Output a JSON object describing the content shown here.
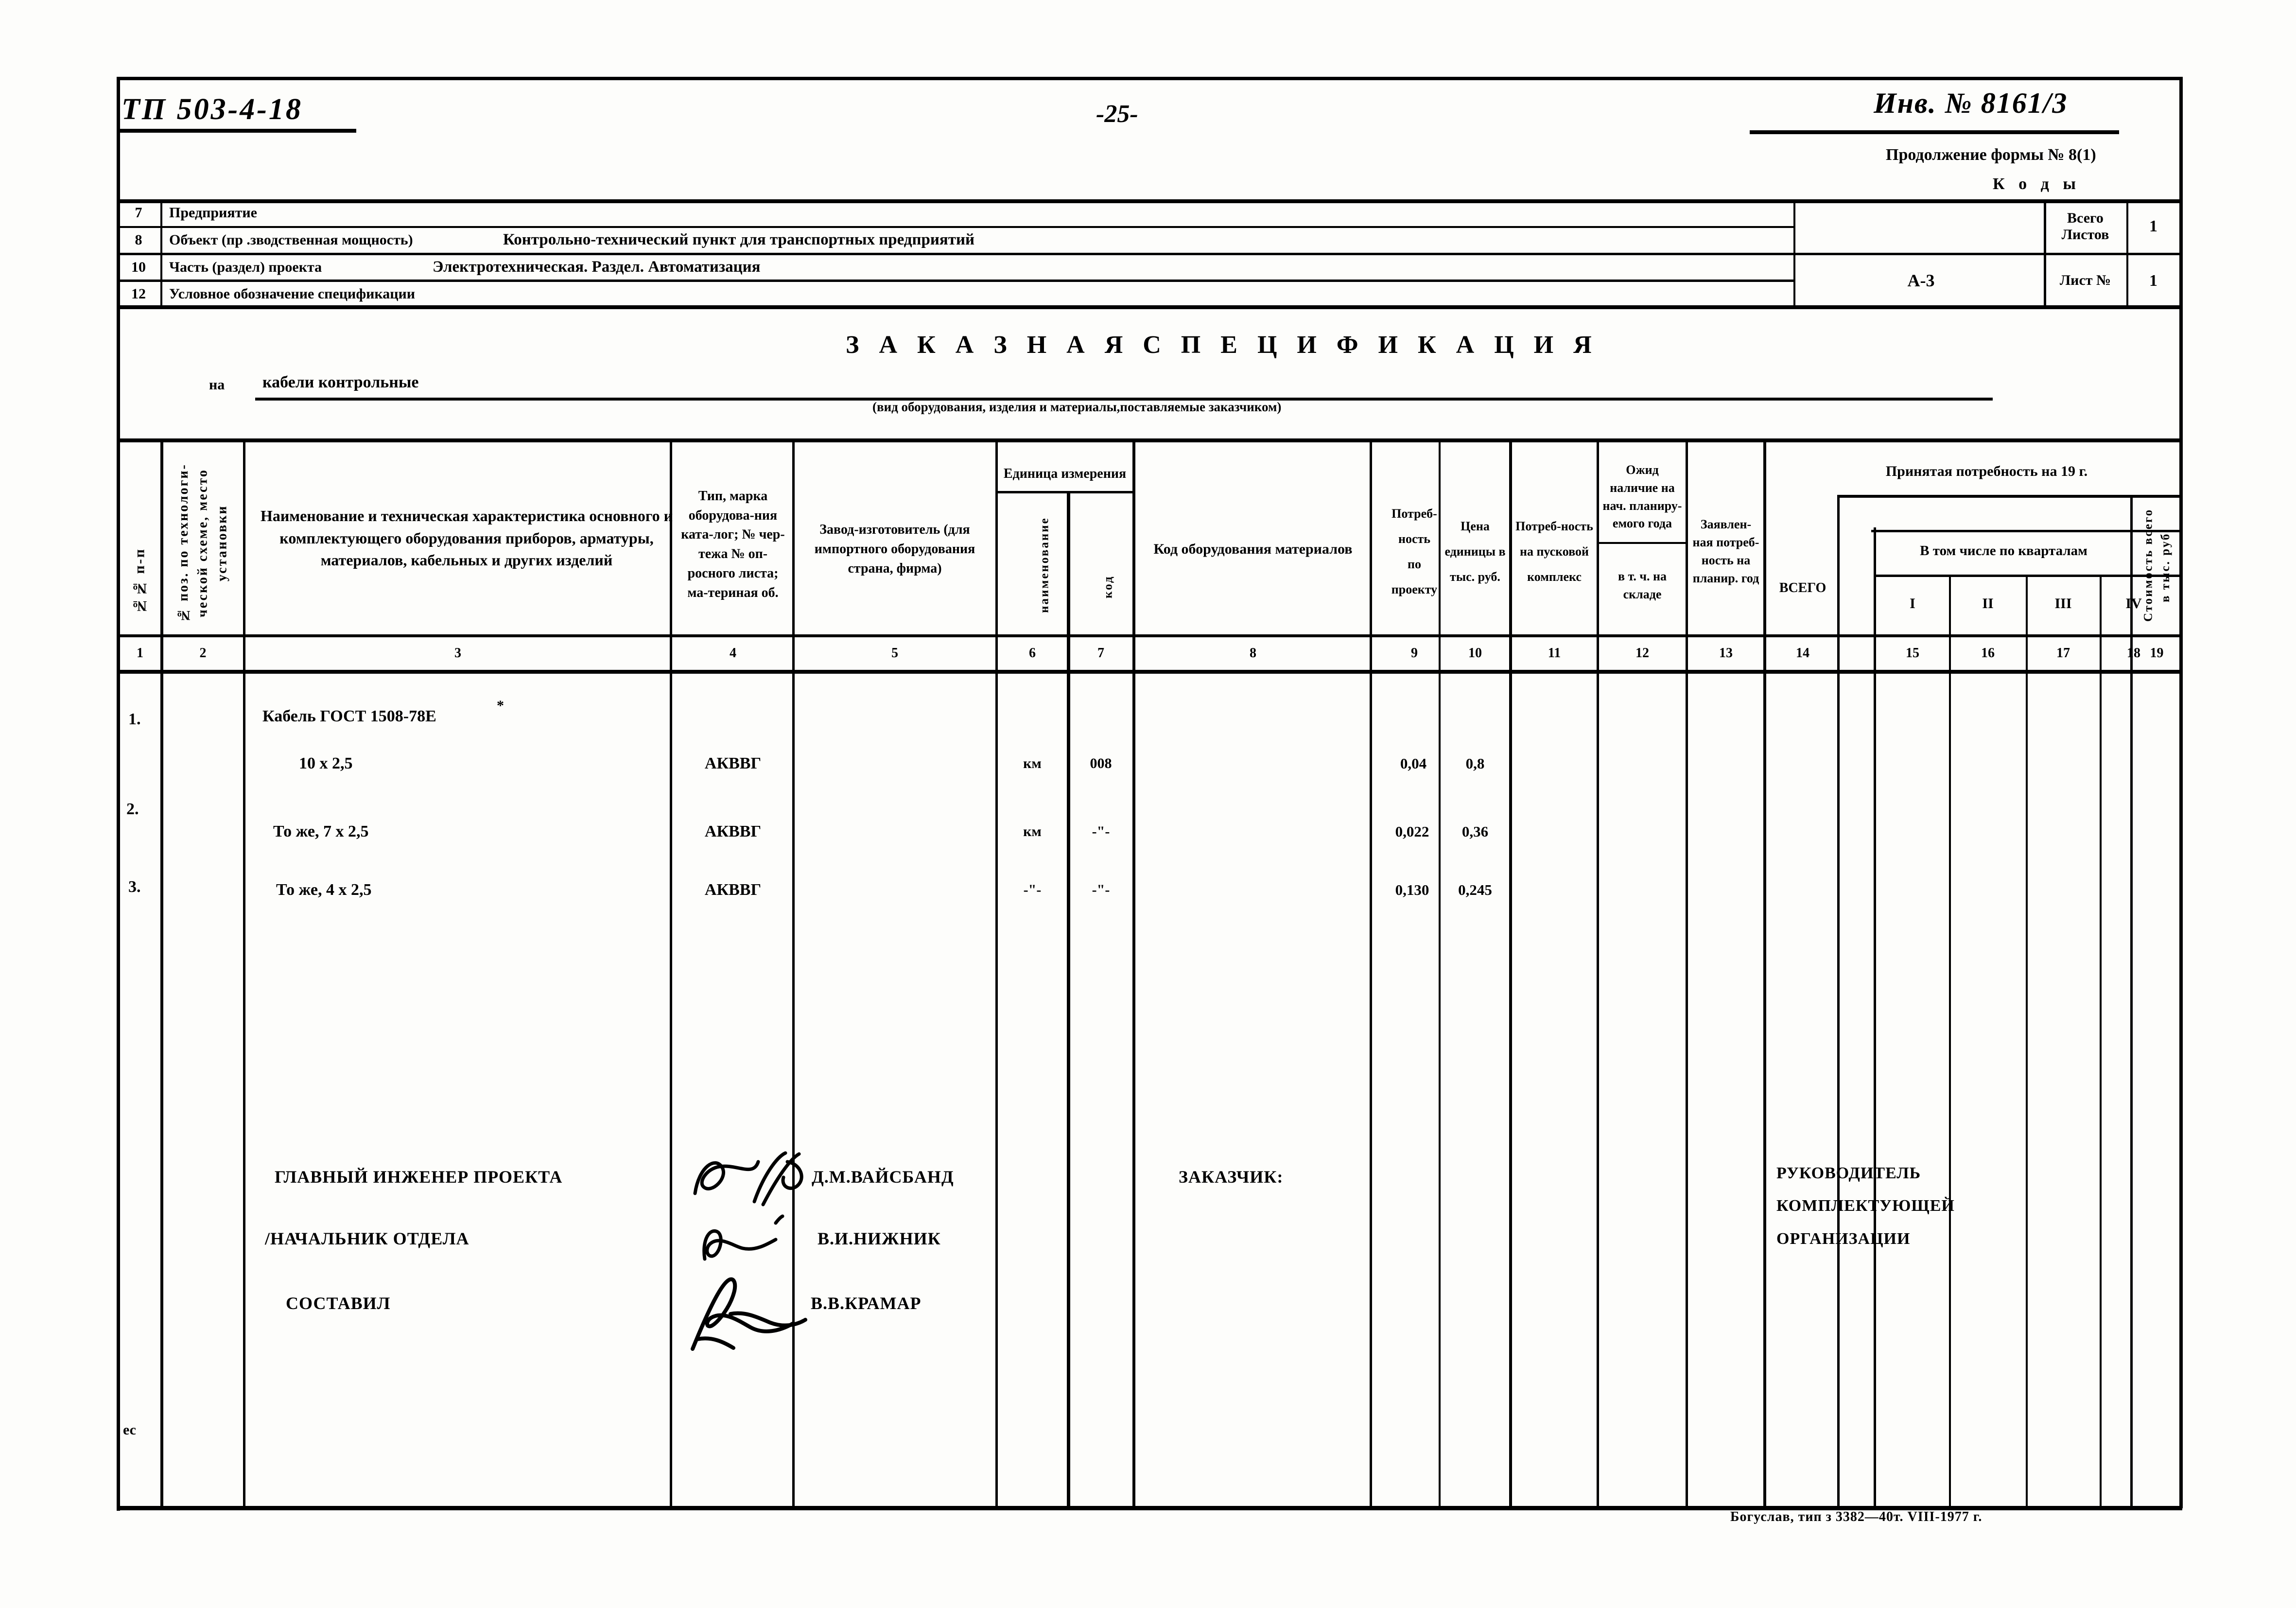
{
  "top": {
    "tp_code": "ТП 503-4-18",
    "page_number": "-25-",
    "inventory_number": "Инв. № 8161/3",
    "form_continuation": "Продолжение формы № 8(1)",
    "kody_label": "К о д ы"
  },
  "header_rows": [
    {
      "num": "7",
      "label": "Предприятие",
      "value": ""
    },
    {
      "num": "8",
      "label": "Объект (пр .зводственная мощность)",
      "value": "Контрольно-технический пункт для транспортных предприятий"
    },
    {
      "num": "10",
      "label": "Часть (раздел) проекта",
      "value": "Электротехническая. Раздел. Автоматизация"
    },
    {
      "num": "12",
      "label": "Условное обозначение спецификации",
      "value": ""
    }
  ],
  "header_right": {
    "spec_code": "А-3",
    "total_sheets_label": "Всего\nЛистов",
    "total_sheets_value": "1",
    "sheet_no_label": "Лист №",
    "sheet_no_value": "1"
  },
  "title": {
    "main": "З А К А З Н А Я   С П Е Ц И Ф И К А Ц И Я",
    "na_label": "на",
    "na_value": "кабели контрольные",
    "subtitle": "(вид оборудования, изделия и материалы,поставляемые заказчиком)"
  },
  "table": {
    "headers": {
      "col1": "№№ п-п",
      "col2": "№ поз. по технологи-ческой схеме, место установки",
      "col3": "Наименование и техническая характеристика основного и комплектующего оборудования приборов, арматуры, материалов, кабельных и других изделий",
      "col4": "Тип, марка оборудова-ния ката-лог; № чер-тежа № оп-росного листа; ма-териная об.",
      "col5": "Завод-изготовитель (для импортного оборудования страна, фирма)",
      "col67_group": "Единица измерения",
      "col6": "наименование",
      "col7": "код",
      "col8": "Код оборудования материалов",
      "col9": "Потреб-ность по проекту",
      "col10": "Цена единицы в тыс. руб.",
      "col11": "Потреб-ность на пусковой комплекс",
      "col12_top": "Ожид наличие на нач. планиру-емого года",
      "col12_bottom": "в т. ч. на складе",
      "col13": "Заявлен-ная потреб-ность на планир. год",
      "col14_19_group": "Принятая потребность на 19        г.",
      "col14": "ВСЕГО",
      "col15_18_group": "В том числе по кварталам",
      "col15": "I",
      "col16": "II",
      "col17": "III",
      "col18": "IV",
      "col19": "Стоимость  всего в тыс. руб."
    },
    "column_numbers": [
      "1",
      "2",
      "3",
      "4",
      "5",
      "6",
      "7",
      "8",
      "9",
      "10",
      "11",
      "12",
      "13",
      "14",
      "15",
      "16",
      "17",
      "18",
      "19"
    ],
    "rows": [
      {
        "num": "1.",
        "pos": "",
        "name_line1": "Кабель ГОСТ 1508-78Е",
        "name_sup": "*",
        "name_line2": "10 х 2,5",
        "type": "АКВВГ",
        "factory": "",
        "unit_name": "км",
        "unit_code": "008",
        "equip_code": "",
        "need_project": "0,04",
        "unit_price": "0,8",
        "need_startup": "",
        "expected_stock": "",
        "declared_need": "",
        "accepted_total": "",
        "q1": "",
        "q2": "",
        "q3": "",
        "q4": "",
        "cost_total": ""
      },
      {
        "num": "2.",
        "pos": "",
        "name_line1": "",
        "name_sup": "",
        "name_line2": "То же,  7 х 2,5",
        "type": "АКВВГ",
        "factory": "",
        "unit_name": "км",
        "unit_code": "-\"-",
        "equip_code": "",
        "need_project": "0,022",
        "unit_price": "0,36",
        "need_startup": "",
        "expected_stock": "",
        "declared_need": "",
        "accepted_total": "",
        "q1": "",
        "q2": "",
        "q3": "",
        "q4": "",
        "cost_total": ""
      },
      {
        "num": "3.",
        "pos": "",
        "name_line1": "",
        "name_sup": "",
        "name_line2": "То же,  4 х 2,5",
        "type": "АКВВГ",
        "factory": "",
        "unit_name": "-\"-",
        "unit_code": "-\"-",
        "equip_code": "",
        "need_project": "0,130",
        "unit_price": "0,245",
        "need_startup": "",
        "expected_stock": "",
        "declared_need": "",
        "accepted_total": "",
        "q1": "",
        "q2": "",
        "q3": "",
        "q4": "",
        "cost_total": ""
      }
    ]
  },
  "signatures": {
    "left": [
      {
        "role": "ГЛАВНЫЙ ИНЖЕНЕР ПРОЕКТА",
        "name": "Д.М.ВАЙСБАНД"
      },
      {
        "role": "/НАЧАЛЬНИК ОТДЕЛА",
        "name": "В.И.НИЖНИК"
      },
      {
        "role": "СОСТАВИЛ",
        "name": "В.В.КРАМАР"
      }
    ],
    "customer_label": "ЗАКАЗЧИК:",
    "right_block": [
      "РУКОВОДИТЕЛЬ",
      "КОМПЛЕКТУЮЩЕЙ",
      "ОРГАНИЗАЦИИ"
    ]
  },
  "footer": {
    "imprint": "Богуслав, тип   з  3382—40т. VIII-1977 г.",
    "es_mark": "ес"
  }
}
